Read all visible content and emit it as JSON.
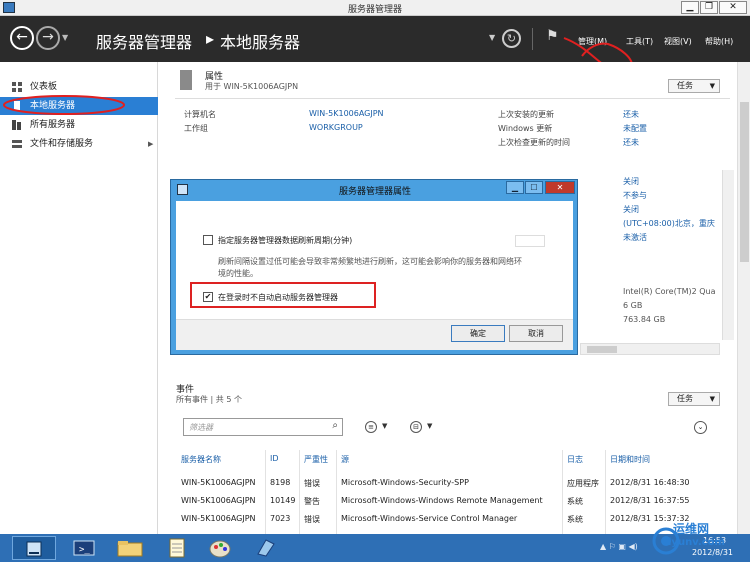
{
  "window": {
    "title": "服务器管理器",
    "min": "▁",
    "max": "❐",
    "close": "✕"
  },
  "header": {
    "crumb1": "服务器管理器",
    "sep": "▸",
    "crumb2": "本地服务器",
    "menus": {
      "manage": "管理(M)",
      "tools": "工具(T)",
      "view": "视图(V)",
      "help": "帮助(H)"
    }
  },
  "sidebar": {
    "items": [
      {
        "label": "仪表板"
      },
      {
        "label": "本地服务器"
      },
      {
        "label": "所有服务器"
      },
      {
        "label": "文件和存储服务"
      }
    ]
  },
  "properties": {
    "title": "属性",
    "subtitle": "用于 WIN-5K1006AGJPN",
    "tasks": "任务",
    "computer_name_label": "计算机名",
    "computer_name": "WIN-5K1006AGJPN",
    "workgroup_label": "工作组",
    "workgroup": "WORKGROUP",
    "last_updates_label": "上次安装的更新",
    "last_updates": "还未",
    "windows_update_label": "Windows 更新",
    "windows_update": "未配置",
    "last_check_label": "上次检查更新的时间",
    "last_check": "还未",
    "right_values": [
      "关闭",
      "不参与",
      "关闭",
      "(UTC+08:00)北京，重庆",
      "未激活"
    ],
    "hw_values": [
      "Intel(R) Core(TM)2 Qua",
      "6 GB",
      "763.84 GB"
    ]
  },
  "events": {
    "title": "事件",
    "subtitle": "所有事件 | 共 5 个",
    "tasks": "任务",
    "filter_placeholder": "筛选器",
    "columns": [
      "服务器名称",
      "ID",
      "严重性",
      "源",
      "日志",
      "日期和时间"
    ],
    "rows": [
      {
        "server": "WIN-5K1006AGJPN",
        "id": "8198",
        "severity": "错误",
        "source": "Microsoft-Windows-Security-SPP",
        "log": "应用程序",
        "time": "2012/8/31 16:48:30"
      },
      {
        "server": "WIN-5K1006AGJPN",
        "id": "10149",
        "severity": "警告",
        "source": "Microsoft-Windows-Windows Remote Management",
        "log": "系统",
        "time": "2012/8/31 16:37:55"
      },
      {
        "server": "WIN-5K1006AGJPN",
        "id": "7023",
        "severity": "错误",
        "source": "Microsoft-Windows-Service Control Manager",
        "log": "系统",
        "time": "2012/8/31 15:37:32"
      }
    ]
  },
  "dialog": {
    "title": "服务器管理器属性",
    "refresh_label": "指定服务器管理器数据刷新周期(分钟)",
    "description": "刷新间隔设置过低可能会导致非常频繁地进行刷新，这可能会影响你的服务器和网络环境的性能。",
    "autostart_label": "在登录时不自动启动服务器管理器",
    "autostart_checked": "✔",
    "ok": "确定",
    "cancel": "取消"
  },
  "taskbar": {
    "time": "16:53",
    "date": "2012/8/31"
  },
  "watermark": {
    "line1": "运维网",
    "line2": "iyunv.com"
  }
}
